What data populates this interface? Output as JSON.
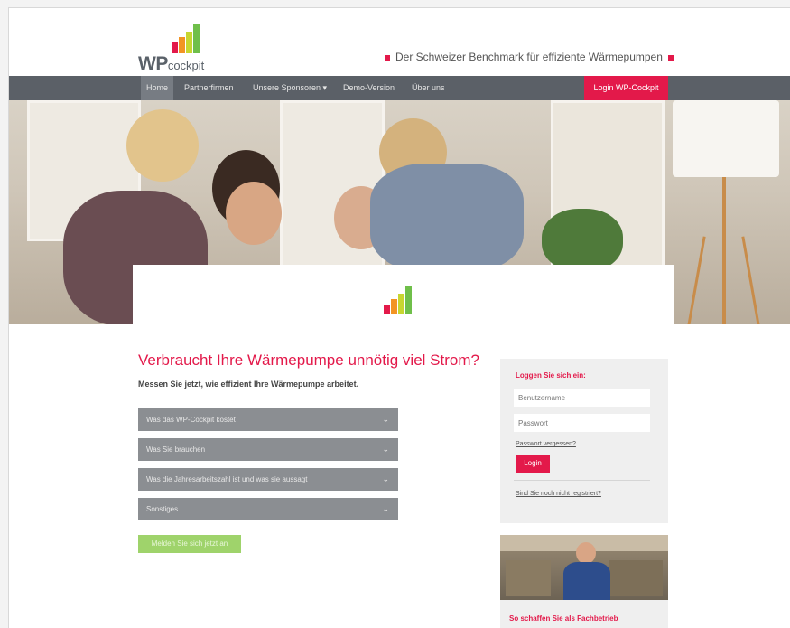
{
  "brand": {
    "name_bold": "WP",
    "name_light": "cockpit",
    "tagline": "Der Schweizer Benchmark für effiziente Wärmepumpen",
    "bar_colors": [
      "#e3194a",
      "#f29423",
      "#c7d630",
      "#6fbf4a"
    ]
  },
  "nav": {
    "items": [
      {
        "label": "Home",
        "active": true
      },
      {
        "label": "Partnerfirmen"
      },
      {
        "label": "Unsere Sponsoren ▾"
      },
      {
        "label": "Demo-Version"
      },
      {
        "label": "Über uns"
      }
    ],
    "login_label": "Login WP-Cockpit"
  },
  "main": {
    "headline": "Verbraucht Ihre Wärmepumpe unnötig viel Strom?",
    "subhead": "Messen Sie jetzt, wie effizient Ihre Wärmepumpe arbeitet.",
    "accordion": [
      {
        "label": "Was das WP-Cockpit kostet"
      },
      {
        "label": "Was Sie brauchen"
      },
      {
        "label": "Was die Jahresarbeitszahl ist und was sie aussagt"
      },
      {
        "label": "Sonstiges"
      }
    ],
    "cta_label": "Melden Sie sich jetzt an"
  },
  "login": {
    "title": "Loggen Sie sich ein:",
    "username_placeholder": "Benutzername",
    "password_placeholder": "Passwort",
    "forgot_label": "Passwort vergessen?",
    "button_label": "Login",
    "register_label": "Sind Sie noch nicht registriert?"
  },
  "promo": {
    "title": "So schaffen Sie als Fachbetrieb"
  },
  "colors": {
    "accent": "#e3194a",
    "nav_bg": "#5b6067",
    "accordion_bg": "#8b8e92",
    "cta_bg": "#9fd36b"
  }
}
